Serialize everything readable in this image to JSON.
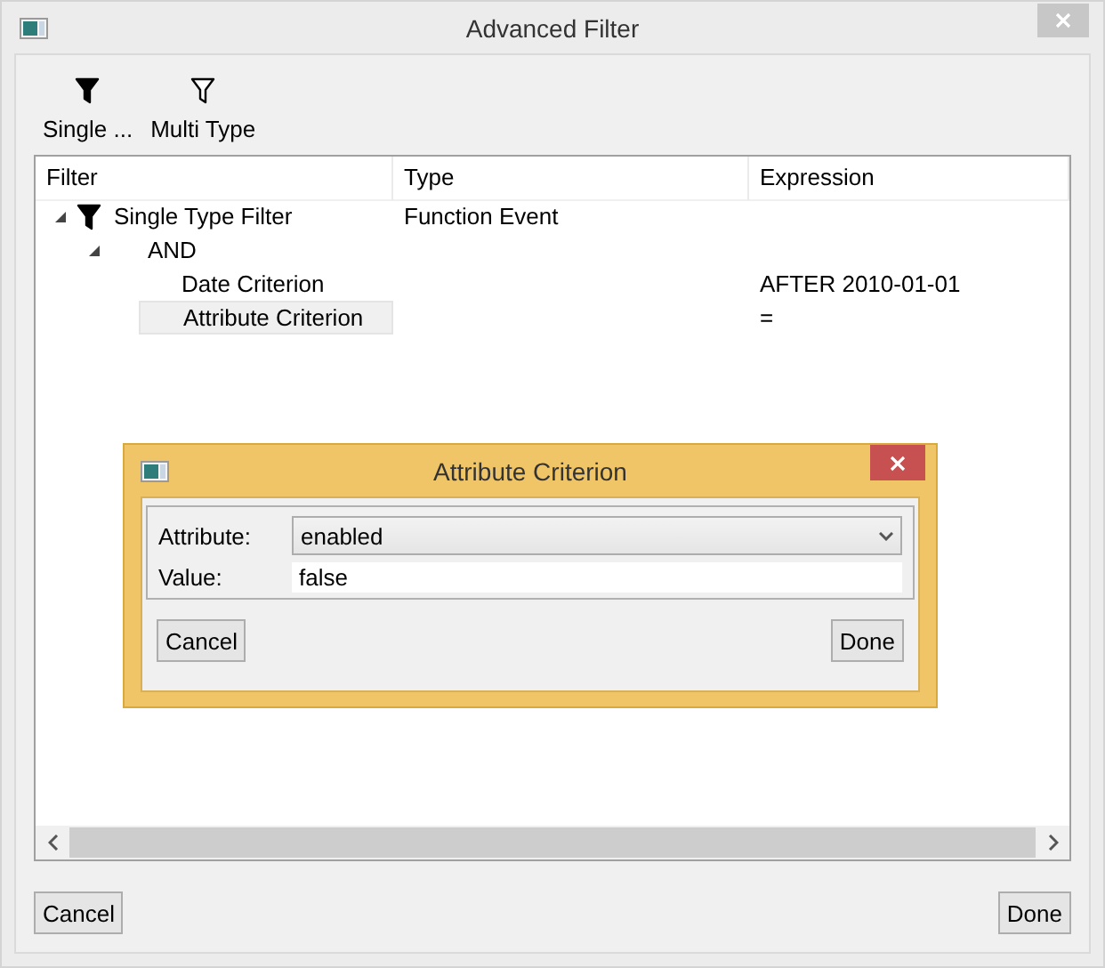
{
  "window": {
    "title": "Advanced Filter"
  },
  "toolbar": [
    {
      "kind": "single",
      "label": "Single ..."
    },
    {
      "kind": "multi",
      "label": "Multi Type"
    }
  ],
  "tree": {
    "columns": [
      "Filter",
      "Type",
      "Expression"
    ],
    "rows": [
      {
        "kind": "filter",
        "filter": "Single Type Filter",
        "type": "Function Event",
        "expanded": true,
        "selected": false,
        "children": [
          {
            "filter": "AND",
            "expanded": true,
            "selected": false,
            "children": [
              {
                "filter": "Date Criterion",
                "expression": "AFTER 2010-01-01",
                "selected": false
              },
              {
                "filter": "Attribute Criterion",
                "expression": "=",
                "selected": true
              }
            ]
          }
        ]
      }
    ]
  },
  "buttons": [
    "Cancel",
    "Done"
  ],
  "dialog": {
    "title": "Attribute Criterion",
    "fields": [
      {
        "kind": "combo",
        "label": "Attribute:",
        "value": "enabled"
      },
      {
        "kind": "text",
        "label": "Value:",
        "value": "false"
      }
    ],
    "buttons": [
      "Cancel",
      "Done"
    ]
  }
}
